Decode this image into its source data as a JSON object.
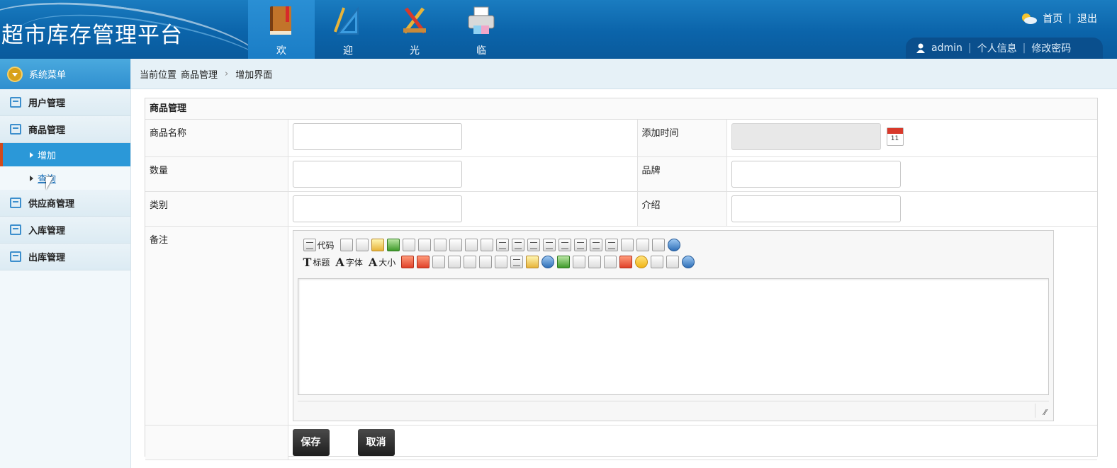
{
  "header": {
    "logo": "超市库存管理平台",
    "nav": [
      {
        "label": "欢",
        "icon": "book-icon"
      },
      {
        "label": "迎",
        "icon": "ruler-icon"
      },
      {
        "label": "光",
        "icon": "tools-icon"
      },
      {
        "label": "临",
        "icon": "printer-icon"
      }
    ],
    "links": {
      "home": "首页",
      "logout": "退出"
    },
    "user": {
      "name": "admin",
      "profile": "个人信息",
      "password": "修改密码"
    }
  },
  "sidebar": {
    "title": "系统菜单",
    "items": [
      {
        "label": "用户管理"
      },
      {
        "label": "商品管理"
      },
      {
        "label": "供应商管理"
      },
      {
        "label": "入库管理"
      },
      {
        "label": "出库管理"
      }
    ],
    "sub": [
      {
        "label": "增加"
      },
      {
        "label": "查询"
      }
    ]
  },
  "breadcrumb": {
    "prefix": "当前位置",
    "section": "商品管理",
    "page": "增加界面"
  },
  "form": {
    "title": "商品管理",
    "fields": {
      "name": "商品名称",
      "time": "添加时间",
      "qty": "数量",
      "brand": "品牌",
      "category": "类别",
      "intro": "介绍",
      "note": "备注"
    },
    "calendar_day": "11",
    "editor_toolbar": {
      "code": "代码",
      "heading": "标题",
      "font": "字体",
      "size": "大小"
    },
    "buttons": {
      "save": "保存",
      "cancel": "取消"
    }
  },
  "colors": {
    "header": "#0b64aa",
    "sidebar_active": "#2b98d8",
    "active_marker": "#d04a1c"
  }
}
